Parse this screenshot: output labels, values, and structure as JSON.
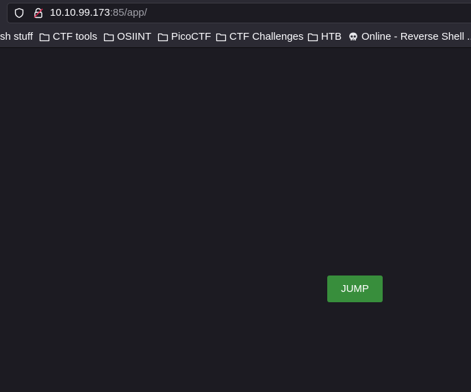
{
  "address_bar": {
    "url_host": "10.10.99.173",
    "url_rest": ":85/app/"
  },
  "bookmarks": [
    {
      "label": "sh stuff",
      "icon": "none"
    },
    {
      "label": "CTF tools",
      "icon": "folder-icon"
    },
    {
      "label": "OSIINT",
      "icon": "folder-icon"
    },
    {
      "label": "PicoCTF",
      "icon": "folder-icon"
    },
    {
      "label": "CTF Challenges",
      "icon": "folder-icon"
    },
    {
      "label": "HTB",
      "icon": "folder-icon"
    },
    {
      "label": "Online - Reverse Shell ...",
      "icon": "skull-icon"
    }
  ],
  "page": {
    "jump_label": "JUMP",
    "button_color": "#388e3c",
    "background_color": "#1c1b22"
  }
}
